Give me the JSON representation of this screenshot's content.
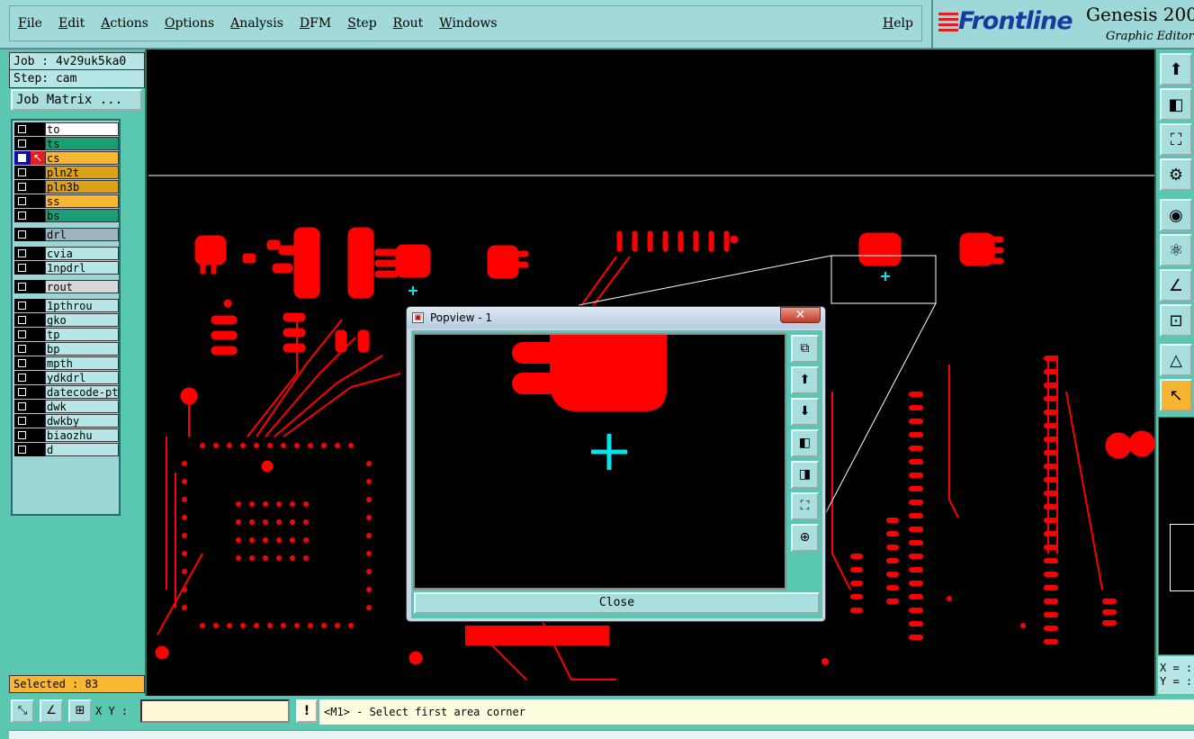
{
  "menu": {
    "items": [
      "File",
      "Edit",
      "Actions",
      "Options",
      "Analysis",
      "DFM",
      "Step",
      "Rout",
      "Windows"
    ],
    "help": "Help"
  },
  "brand": {
    "logo": "Frontline",
    "product": "Genesis 200",
    "subtitle": "Graphic Editor"
  },
  "job": {
    "job_line": "Job : 4v29uk5ka0",
    "step_line": "Step: cam",
    "matrix_button": "Job Matrix ..."
  },
  "layers": [
    {
      "name": "to",
      "color": "#ffffff"
    },
    {
      "name": "ts",
      "color": "#1a9e78"
    },
    {
      "name": "cs",
      "color": "#f7b733",
      "active": true
    },
    {
      "name": "pln2t",
      "color": "#d9a21a"
    },
    {
      "name": "pln3b",
      "color": "#d9a21a"
    },
    {
      "name": "ss",
      "color": "#f7b733"
    },
    {
      "name": "bs",
      "color": "#1a9e78"
    },
    {
      "name": "drl",
      "color": "#9cb4bc"
    },
    {
      "name": "cvia",
      "color": "#b7e6e6"
    },
    {
      "name": "1npdrl",
      "color": "#b7e6e6"
    },
    {
      "name": "rout",
      "color": "#d8d8d8"
    },
    {
      "name": "1pthrou",
      "color": "#b7e6e6"
    },
    {
      "name": "gko",
      "color": "#b7e6e6"
    },
    {
      "name": "tp",
      "color": "#b7e6e6"
    },
    {
      "name": "bp",
      "color": "#b7e6e6"
    },
    {
      "name": "mpth",
      "color": "#b7e6e6"
    },
    {
      "name": "ydkdrl",
      "color": "#b7e6e6"
    },
    {
      "name": "datecode-pt",
      "color": "#b7e6e6"
    },
    {
      "name": "dwk",
      "color": "#b7e6e6"
    },
    {
      "name": "dwkby",
      "color": "#b7e6e6"
    },
    {
      "name": "biaozhu",
      "color": "#b7e6e6"
    },
    {
      "name": "d",
      "color": "#b7e6e6"
    }
  ],
  "status": {
    "selected": "Selected : 83"
  },
  "right_tools": [
    {
      "icon": "move-up-icon",
      "glyph": "⬆"
    },
    {
      "icon": "move-left-icon",
      "glyph": "◧"
    },
    {
      "icon": "zoom-fit-icon",
      "glyph": "⛶"
    },
    {
      "icon": "tools-icon",
      "glyph": "⚙"
    },
    {
      "icon": "camera-icon",
      "glyph": "◉"
    },
    {
      "icon": "network-icon",
      "glyph": "⚛"
    },
    {
      "icon": "measure-icon",
      "glyph": "∠"
    },
    {
      "icon": "snap-icon",
      "glyph": "⊡"
    },
    {
      "icon": "ruler-icon",
      "glyph": "△"
    },
    {
      "icon": "pointer-icon",
      "glyph": "↖"
    }
  ],
  "xy_readout": {
    "x": "X = :",
    "y": "Y = :"
  },
  "popview": {
    "title": "Popview - 1",
    "close_x": "✕",
    "close_button": "Close",
    "tools": [
      "⧉",
      "⬆",
      "⬇",
      "◧",
      "◨",
      "⛶",
      "⊕"
    ]
  },
  "bottom": {
    "xy_label": "X Y :",
    "xy_value": "",
    "warn": "!",
    "prompt": "<M1> - Select first area corner"
  },
  "colors": {
    "copper": "#ff0000",
    "cursor": "#00e5ee",
    "panel": "#5ac8b0",
    "menu": "#9fd8d8"
  }
}
